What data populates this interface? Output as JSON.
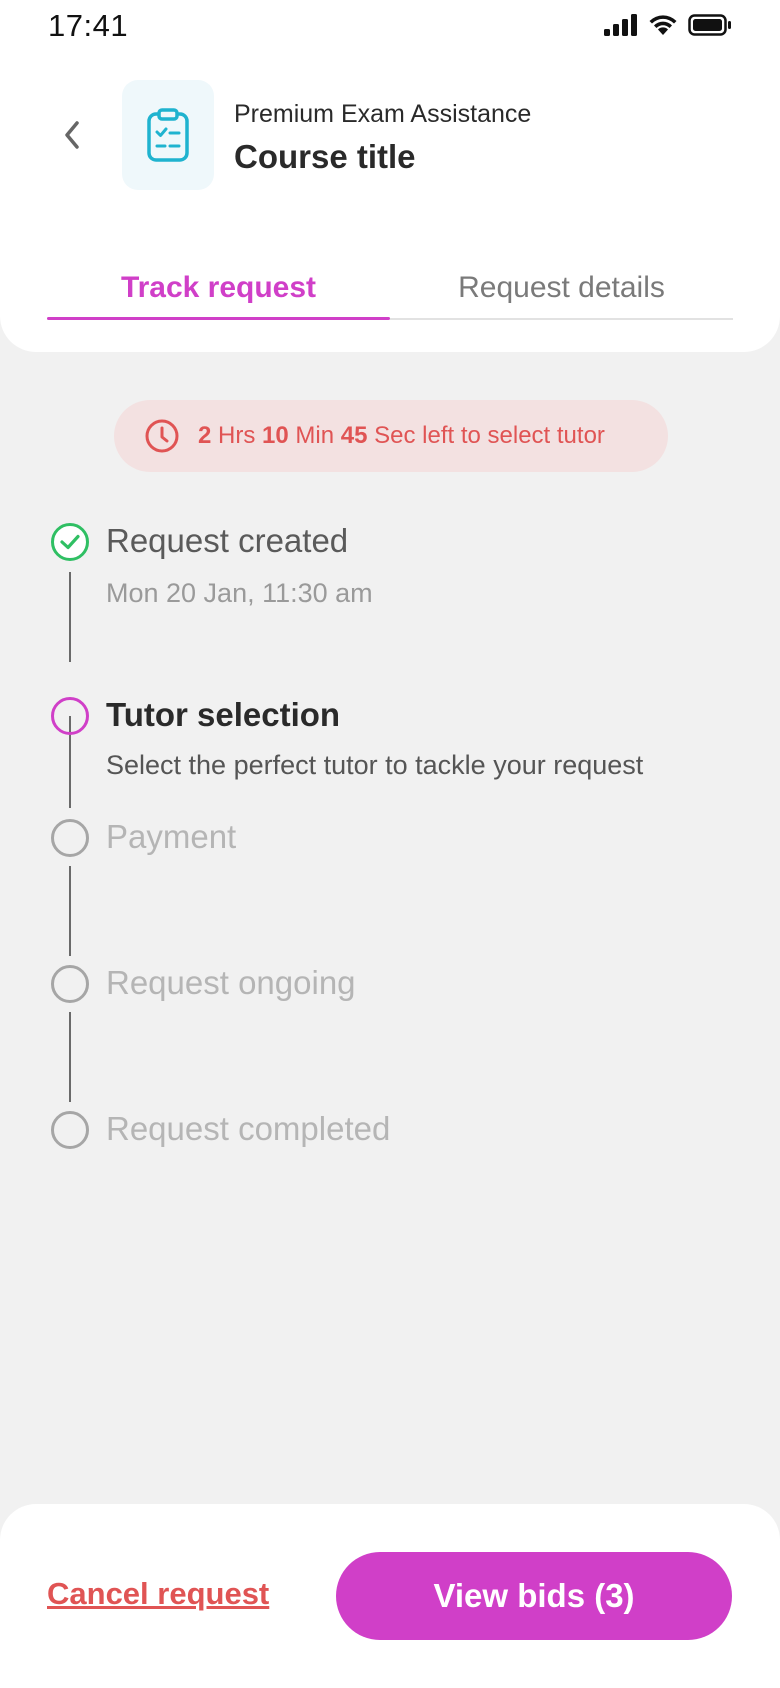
{
  "status_bar": {
    "time": "17:41"
  },
  "header": {
    "subtitle": "Premium Exam Assistance",
    "title": "Course title"
  },
  "tabs": [
    {
      "label": "Track request",
      "active": true
    },
    {
      "label": "Request details",
      "active": false
    }
  ],
  "timer": {
    "hours": "2",
    "hours_unit": "Hrs",
    "minutes": "10",
    "minutes_unit": "Min",
    "seconds": "45",
    "seconds_unit": "Sec left to select tutor"
  },
  "timeline": [
    {
      "title": "Request created",
      "subtitle": "Mon 20 Jan, 11:30 am",
      "state": "done"
    },
    {
      "title": "Tutor selection",
      "subtitle": "Select the perfect tutor to tackle your request",
      "state": "active"
    },
    {
      "title": "Payment",
      "subtitle": "",
      "state": "pending"
    },
    {
      "title": "Request ongoing",
      "subtitle": "",
      "state": "pending"
    },
    {
      "title": "Request completed",
      "subtitle": "",
      "state": "pending"
    }
  ],
  "actions": {
    "cancel_label": "Cancel request",
    "view_bids_label": "View bids (3)"
  },
  "colors": {
    "accent": "#d03fc8",
    "danger": "#e05454",
    "success": "#2fbf63",
    "icon_teal": "#1fb3cf"
  },
  "icons": {
    "back": "chevron-left-icon",
    "course": "clipboard-checklist-icon",
    "timer": "clock-icon",
    "done": "check-circle-icon"
  }
}
